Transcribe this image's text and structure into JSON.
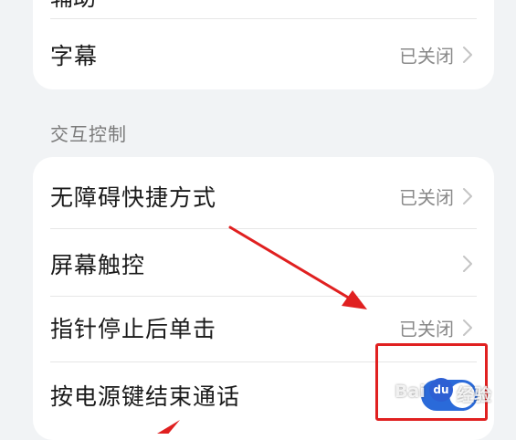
{
  "top_section": {
    "partial_item_label": "辅助",
    "subtitles": {
      "label": "字幕",
      "status": "已关闭"
    }
  },
  "interaction_section": {
    "header": "交互控制",
    "items": [
      {
        "label": "无障碍快捷方式",
        "status": "已关闭",
        "control": "chevron"
      },
      {
        "label": "屏幕触控",
        "status": "",
        "control": "chevron"
      },
      {
        "label": "指针停止后单击",
        "status": "已关闭",
        "control": "chevron"
      },
      {
        "label": "按电源键结束通话",
        "status": "",
        "control": "toggle",
        "toggle_on": true
      }
    ]
  },
  "watermark": {
    "text": "Bai",
    "logo_text": "du",
    "suffix": "经验"
  },
  "colors": {
    "background": "#f1f3f5",
    "card": "#ffffff",
    "primary_text": "#1a1a1a",
    "secondary_text": "#8a8a8a",
    "section_header": "#7a7a7a",
    "toggle_on": "#2a6ad9",
    "annotation_red": "#e02020"
  },
  "icons": {
    "chevron": "chevron-right-icon",
    "arrow": "red-arrow-annotation"
  }
}
